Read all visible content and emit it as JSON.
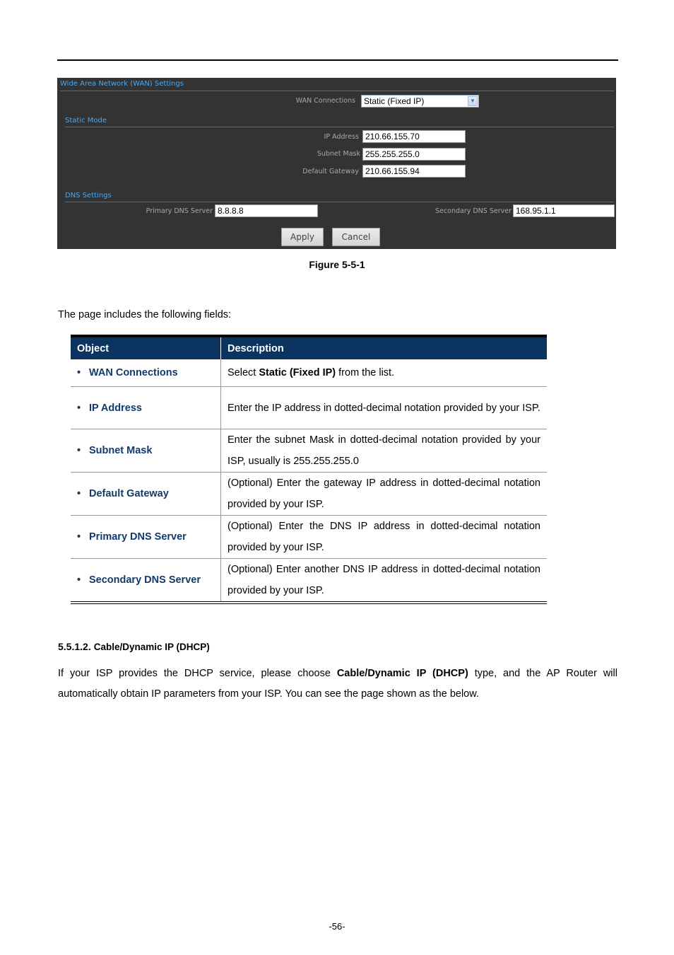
{
  "screenshot": {
    "title": "Wide Area Network (WAN) Settings",
    "wan_connections_label": "WAN Connections",
    "wan_connections_value": "Static (Fixed IP)",
    "static_mode_title": "Static Mode",
    "ip_address_label": "IP Address",
    "ip_address_value": "210.66.155.70",
    "subnet_mask_label": "Subnet Mask",
    "subnet_mask_value": "255.255.255.0",
    "default_gateway_label": "Default Gateway",
    "default_gateway_value": "210.66.155.94",
    "dns_title": "DNS Settings",
    "primary_dns_label": "Primary DNS Server",
    "primary_dns_value": "8.8.8.8",
    "secondary_dns_label": "Secondary DNS Server",
    "secondary_dns_value": "168.95.1.1",
    "apply_label": "Apply",
    "cancel_label": "Cancel",
    "select_arrow_icon": "chevron-down-icon"
  },
  "figure_caption": "Figure 5-5-1",
  "intro": "The page includes the following fields:",
  "table": {
    "headers": [
      "Object",
      "Description"
    ],
    "rows": [
      {
        "object": "WAN Connections",
        "desc_pre": "Select ",
        "desc_bold": "Static (Fixed IP)",
        "desc_post": " from the list."
      },
      {
        "object": "IP Address",
        "desc_pre": "Enter the IP address in dotted-decimal notation provided by your ISP.",
        "desc_bold": "",
        "desc_post": ""
      },
      {
        "object": "Subnet Mask",
        "desc_pre": "Enter the subnet Mask in dotted-decimal notation provided by your ISP, usually is 255.255.255.0",
        "desc_bold": "",
        "desc_post": ""
      },
      {
        "object": "Default Gateway",
        "desc_pre": "(Optional) Enter the gateway IP address in dotted-decimal notation provided by your ISP.",
        "desc_bold": "",
        "desc_post": ""
      },
      {
        "object": "Primary DNS Server",
        "desc_pre": "(Optional) Enter the DNS IP address in dotted-decimal notation provided by your ISP.",
        "desc_bold": "",
        "desc_post": ""
      },
      {
        "object": "Secondary DNS Server",
        "desc_pre": "(Optional) Enter another DNS IP address in dotted-decimal notation provided by your ISP.",
        "desc_bold": "",
        "desc_post": ""
      }
    ]
  },
  "section": {
    "number": "5.5.1.2.",
    "title": "Cable/Dynamic IP (DHCP)",
    "para_pre": "If your ISP provides the DHCP service, please choose ",
    "para_bold": "Cable/Dynamic IP (DHCP)",
    "para_post": " type, and the AP Router will automatically obtain IP parameters from your ISP. You can see the page shown as the below."
  },
  "page_number": "-56-",
  "bullet": "•"
}
